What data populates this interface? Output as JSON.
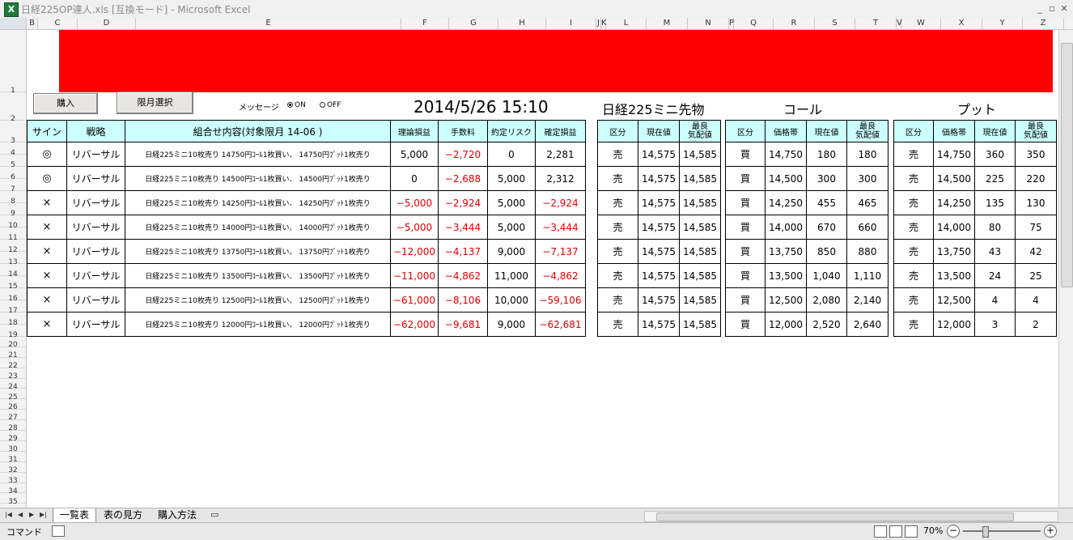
{
  "window": {
    "app_icon_label": "X",
    "title": "日経225OP達人.xls  [互換モード] - Microsoft Excel"
  },
  "columns": [
    "B",
    "C",
    "D",
    "E",
    "F",
    "G",
    "H",
    "I",
    "J",
    "K",
    "L",
    "M",
    "N",
    "P",
    "Q",
    "R",
    "S",
    "T",
    "V",
    "W",
    "X",
    "Y",
    "Z"
  ],
  "rows": [
    "1",
    "2",
    "3",
    "4",
    "5",
    "6",
    "7",
    "8",
    "9",
    "10",
    "11",
    "12",
    "13",
    "14",
    "15",
    "16",
    "17",
    "18",
    "19",
    "20",
    "21",
    "22",
    "23",
    "24",
    "25",
    "26",
    "27",
    "28",
    "29",
    "30",
    "31",
    "32",
    "33",
    "34",
    "35"
  ],
  "controls": {
    "buy_button": "購入",
    "month_select_button": "限月選択",
    "message_label": "メッセージ",
    "radio_on": "ON",
    "radio_off": "OFF"
  },
  "header": {
    "datetime": "2014/5/26 15:10",
    "product": "日経225ミニ先物",
    "call": "コール",
    "put": "プット"
  },
  "main_table": {
    "headers": [
      "サイン",
      "戦略",
      "組合せ内容(対象限月 14-06 )",
      "理論損益",
      "手数料",
      "約定リスク",
      "確定損益"
    ],
    "rows": [
      {
        "sign": "◎",
        "strategy": "リバーサル",
        "combo": "日経225ミニ10枚売り 14750円ｺｰﾙ1枚買い、 14750円ﾌﾟｯﾄ1枚売り",
        "theory": "5,000",
        "fee": "−2,720",
        "risk": "0",
        "fixed": "2,281"
      },
      {
        "sign": "◎",
        "strategy": "リバーサル",
        "combo": "日経225ミニ10枚売り 14500円ｺｰﾙ1枚買い、 14500円ﾌﾟｯﾄ1枚売り",
        "theory": "0",
        "fee": "−2,688",
        "risk": "5,000",
        "fixed": "2,312"
      },
      {
        "sign": "×",
        "strategy": "リバーサル",
        "combo": "日経225ミニ10枚売り 14250円ｺｰﾙ1枚買い、 14250円ﾌﾟｯﾄ1枚売り",
        "theory": "−5,000",
        "fee": "−2,924",
        "risk": "5,000",
        "fixed": "−2,924"
      },
      {
        "sign": "×",
        "strategy": "リバーサル",
        "combo": "日経225ミニ10枚売り 14000円ｺｰﾙ1枚買い、 14000円ﾌﾟｯﾄ1枚売り",
        "theory": "−5,000",
        "fee": "−3,444",
        "risk": "5,000",
        "fixed": "−3,444"
      },
      {
        "sign": "×",
        "strategy": "リバーサル",
        "combo": "日経225ミニ10枚売り 13750円ｺｰﾙ1枚買い、 13750円ﾌﾟｯﾄ1枚売り",
        "theory": "−12,000",
        "fee": "−4,137",
        "risk": "9,000",
        "fixed": "−7,137"
      },
      {
        "sign": "×",
        "strategy": "リバーサル",
        "combo": "日経225ミニ10枚売り 13500円ｺｰﾙ1枚買い、 13500円ﾌﾟｯﾄ1枚売り",
        "theory": "−11,000",
        "fee": "−4,862",
        "risk": "11,000",
        "fixed": "−4,862"
      },
      {
        "sign": "×",
        "strategy": "リバーサル",
        "combo": "日経225ミニ10枚売り 12500円ｺｰﾙ1枚買い、 12500円ﾌﾟｯﾄ1枚売り",
        "theory": "−61,000",
        "fee": "−8,106",
        "risk": "10,000",
        "fixed": "−59,106"
      },
      {
        "sign": "×",
        "strategy": "リバーサル",
        "combo": "日経225ミニ10枚売り 12000円ｺｰﾙ1枚買い、 12000円ﾌﾟｯﾄ1枚売り",
        "theory": "−62,000",
        "fee": "−9,681",
        "risk": "9,000",
        "fixed": "−62,681"
      }
    ]
  },
  "futures_table": {
    "headers": [
      "区分",
      "現在値",
      "最良",
      "気配値"
    ],
    "rows": [
      [
        "売",
        "14,575",
        "14,585"
      ],
      [
        "売",
        "14,575",
        "14,585"
      ],
      [
        "売",
        "14,575",
        "14,585"
      ],
      [
        "売",
        "14,575",
        "14,585"
      ],
      [
        "売",
        "14,575",
        "14,585"
      ],
      [
        "売",
        "14,575",
        "14,585"
      ],
      [
        "売",
        "14,575",
        "14,585"
      ],
      [
        "売",
        "14,575",
        "14,585"
      ]
    ]
  },
  "call_table": {
    "headers": [
      "区分",
      "価格帯",
      "現在値",
      "最良",
      "気配値"
    ],
    "rows": [
      [
        "買",
        "14,750",
        "180",
        "180"
      ],
      [
        "買",
        "14,500",
        "300",
        "300"
      ],
      [
        "買",
        "14,250",
        "455",
        "465"
      ],
      [
        "買",
        "14,000",
        "670",
        "660"
      ],
      [
        "買",
        "13,750",
        "850",
        "880"
      ],
      [
        "買",
        "13,500",
        "1,040",
        "1,110"
      ],
      [
        "買",
        "12,500",
        "2,080",
        "2,140"
      ],
      [
        "買",
        "12,000",
        "2,520",
        "2,640"
      ]
    ]
  },
  "put_table": {
    "headers": [
      "区分",
      "価格帯",
      "現在値",
      "最良",
      "気配値"
    ],
    "rows": [
      [
        "売",
        "14,750",
        "360",
        "350"
      ],
      [
        "売",
        "14,500",
        "225",
        "220"
      ],
      [
        "売",
        "14,250",
        "135",
        "130"
      ],
      [
        "売",
        "14,000",
        "80",
        "75"
      ],
      [
        "売",
        "13,750",
        "43",
        "42"
      ],
      [
        "売",
        "13,500",
        "24",
        "25"
      ],
      [
        "売",
        "12,500",
        "4",
        "4"
      ],
      [
        "売",
        "12,000",
        "3",
        "2"
      ]
    ]
  },
  "tabs": [
    "一覧表",
    "表の見方",
    "購入方法"
  ],
  "status": {
    "mode": "コマンド",
    "zoom": "70%"
  }
}
